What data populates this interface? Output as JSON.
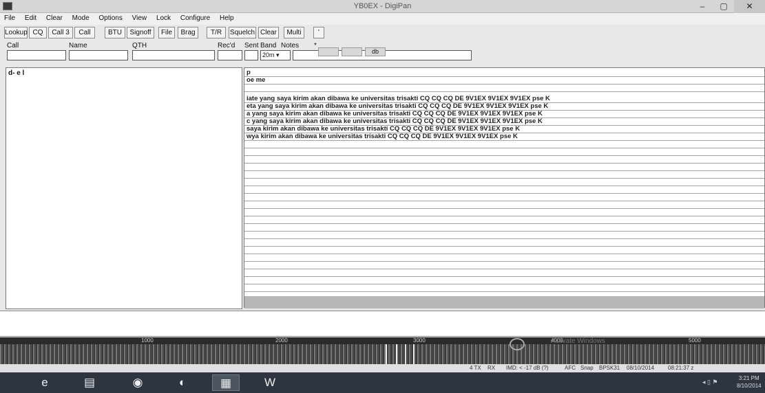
{
  "window": {
    "title": "YB0EX - DigiPan",
    "minimize": "–",
    "maximize": "▢",
    "close": "✕"
  },
  "menu": [
    "File",
    "Edit",
    "Clear",
    "Mode",
    "Options",
    "View",
    "Lock",
    "Configure",
    "Help"
  ],
  "toolbar": [
    "Lookup",
    "CQ",
    "Call 3",
    "Call",
    "BTU",
    "Signoff",
    "File",
    "Brag",
    "T/R",
    "Squelch",
    "Clear",
    "Multi",
    "'"
  ],
  "fields": {
    "call_label": "Call",
    "name_label": "Name",
    "qth_label": "QTH",
    "recd_label": "Rec'd",
    "sent_label": "Sent",
    "band_label": "Band",
    "notes_label": "Notes",
    "notes_star": "*",
    "band_value": "20m",
    "color_buttons": [
      "",
      "",
      "db"
    ]
  },
  "left_pane": {
    "text": "d-   e l"
  },
  "right_pane": {
    "lines": [
      "p",
      "oe me",
      "",
      "iate yang saya kirim akan dibawa ke universitas trisakti CQ CQ CQ DE 9V1EX 9V1EX 9V1EX pse K",
      "eta yang saya kirim akan dibawa ke universitas trisakti CQ CQ CQ DE 9V1EX 9V1EX 9V1EX pse K",
      "a yang saya kirim akan dibawa ke universitas trisakti CQ CQ CQ DE 9V1EX 9V1EX 9V1EX pse K",
      "c yang saya kirim akan dibawa ke universitas trisakti CQ CQ CQ DE 9V1EX 9V1EX 9V1EX pse K",
      " saya kirim akan dibawa ke universitas trisakti CQ CQ CQ DE 9V1EX 9V1EX 9V1EX pse K",
      "wya kirim akan dibawa ke universitas trisakti CQ CQ CQ DE 9V1EX 9V1EX 9V1EX pse K"
    ]
  },
  "waterfall": {
    "scale": [
      "1000",
      "2000",
      "3000",
      "4000",
      "5000"
    ],
    "watermark": "Activate Windows"
  },
  "status": [
    "4 TX",
    "RX",
    "IMD: < -17 dB (?)",
    "AFC",
    "Snap",
    "BPSK31",
    "08/10/2014",
    "08:21:37 z"
  ],
  "taskbar": {
    "icons": [
      "internet-explorer-icon",
      "file-explorer-icon",
      "media-icon",
      "firefox-icon",
      "digipan-icon",
      "word-icon"
    ],
    "tray": "◂ ▯ ⚑",
    "time": "3:21 PM",
    "date": "8/10/2014"
  }
}
